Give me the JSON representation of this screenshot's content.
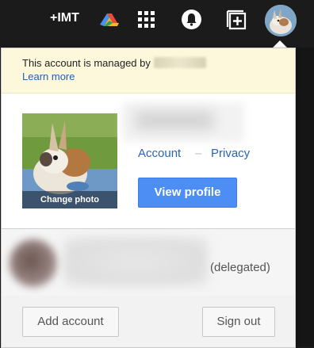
{
  "topbar": {
    "plus_name": "+IMT",
    "icons": [
      "multicolor-triangle-icon",
      "apps-grid-icon",
      "notifications-bell-icon",
      "share-plus-icon"
    ]
  },
  "managed_banner": {
    "text": "This account is managed by",
    "learn_more": "Learn more",
    "background": "#fdf8dc"
  },
  "profile": {
    "change_photo": "Change photo",
    "account_link": "Account",
    "separator": "–",
    "privacy_link": "Privacy",
    "view_profile": "View profile",
    "link_color": "#2b64b7",
    "button_color": "#4d8ef5"
  },
  "delegated_account": {
    "label": "(delegated)"
  },
  "footer": {
    "add_account": "Add account",
    "sign_out": "Sign out"
  }
}
